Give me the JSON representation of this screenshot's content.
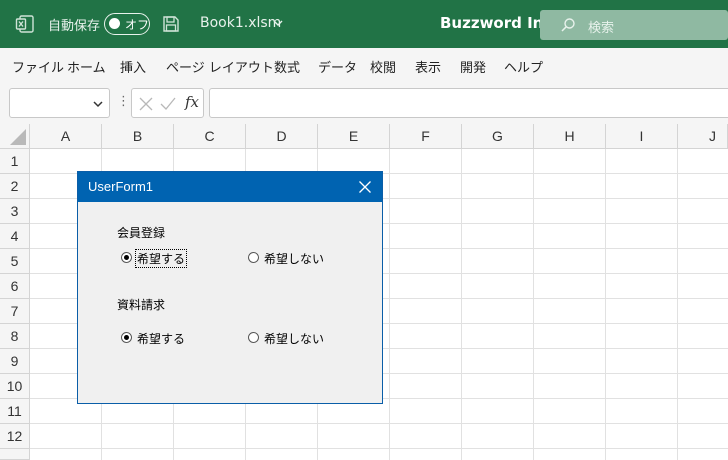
{
  "titlebar": {
    "autosave_label": "自動保存",
    "autosave_state": "オフ",
    "filename": "Book1.xlsm",
    "company": "Buzzword Inc.",
    "search_placeholder": "検索",
    "accent": "#217346"
  },
  "menu": [
    "ファイル",
    "ホーム",
    "挿入",
    "ページ レイアウト",
    "数式",
    "データ",
    "校閲",
    "表示",
    "開発",
    "ヘルプ"
  ],
  "formula_bar": {
    "name_box": "",
    "fx_label": "fx",
    "formula": ""
  },
  "grid": {
    "columns": [
      "A",
      "B",
      "C",
      "D",
      "E",
      "F",
      "G",
      "H",
      "I",
      "J"
    ],
    "rows": [
      "1",
      "2",
      "3",
      "4",
      "5",
      "6",
      "7",
      "8",
      "9",
      "10",
      "11",
      "12"
    ]
  },
  "userform": {
    "title": "UserForm1",
    "title_color": "#0063b1",
    "groups": [
      {
        "label": "会員登録",
        "options": [
          {
            "label": "希望する",
            "selected": true,
            "focused": true
          },
          {
            "label": "希望しない",
            "selected": false,
            "focused": false
          }
        ]
      },
      {
        "label": "資料請求",
        "options": [
          {
            "label": "希望する",
            "selected": true,
            "focused": false
          },
          {
            "label": "希望しない",
            "selected": false,
            "focused": false
          }
        ]
      }
    ]
  }
}
